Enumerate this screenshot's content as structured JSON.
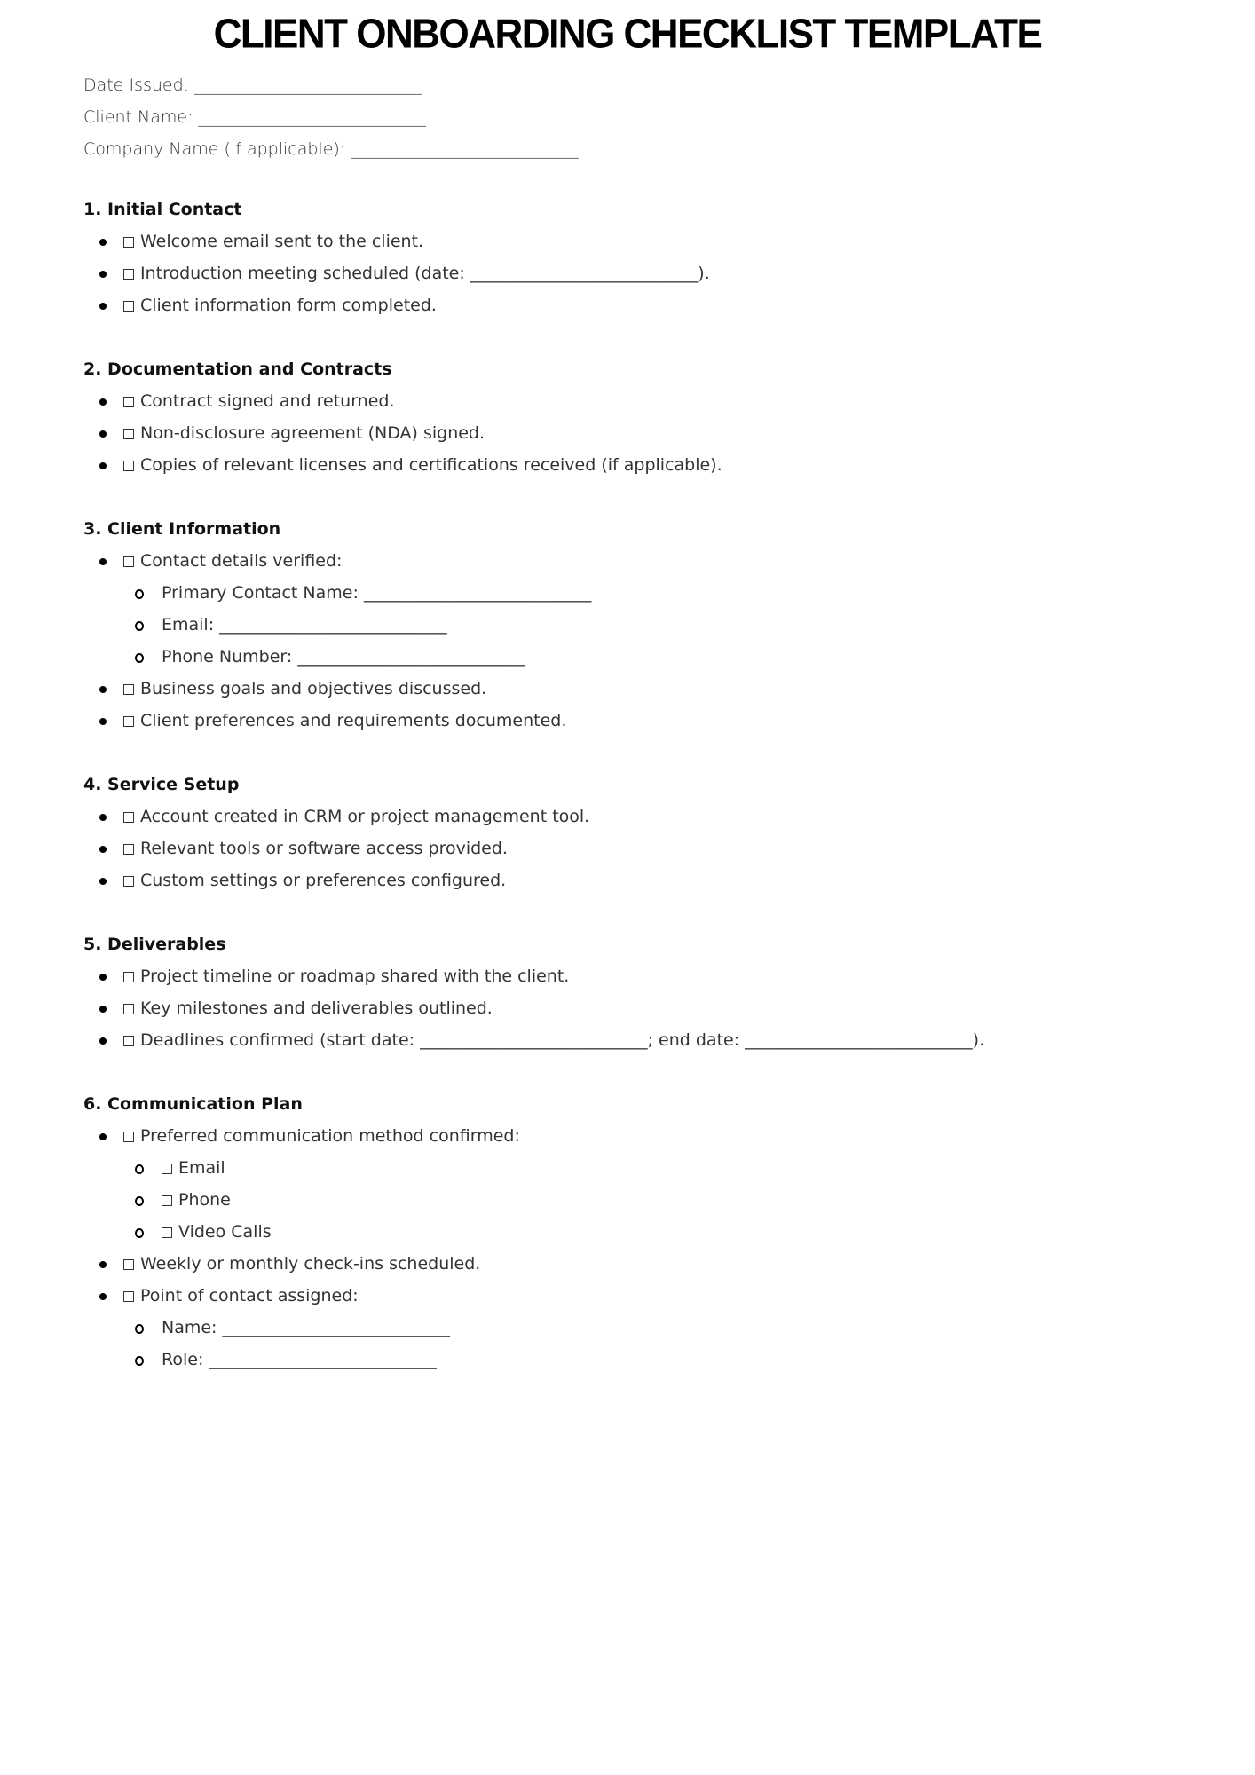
{
  "title": "CLIENT ONBOARDING CHECKLIST TEMPLATE",
  "meta": [
    "Date Issued: ___________________________",
    "Client Name: ___________________________",
    "Company Name (if applicable): ___________________________"
  ],
  "sections": [
    {
      "heading": "1. Initial Contact",
      "items": [
        {
          "text": "Welcome email sent to the client.",
          "checkbox": true
        },
        {
          "text": "Introduction meeting scheduled (date: ___________________________).",
          "checkbox": true
        },
        {
          "text": "Client information form completed.",
          "checkbox": true
        }
      ]
    },
    {
      "heading": "2. Documentation and Contracts",
      "items": [
        {
          "text": "Contract signed and returned.",
          "checkbox": true
        },
        {
          "text": "Non-disclosure agreement (NDA) signed.",
          "checkbox": true
        },
        {
          "text": "Copies of relevant licenses and certifications received (if applicable).",
          "checkbox": true
        }
      ]
    },
    {
      "heading": "3. Client Information",
      "items": [
        {
          "text": "Contact details verified:",
          "checkbox": true,
          "sub": [
            {
              "text": "Primary Contact Name: ___________________________",
              "checkbox": false
            },
            {
              "text": "Email: ___________________________",
              "checkbox": false
            },
            {
              "text": "Phone Number: ___________________________",
              "checkbox": false
            }
          ]
        },
        {
          "text": "Business goals and objectives discussed.",
          "checkbox": true
        },
        {
          "text": "Client preferences and requirements documented.",
          "checkbox": true
        }
      ]
    },
    {
      "heading": "4. Service Setup",
      "items": [
        {
          "text": "Account created in CRM or project management tool.",
          "checkbox": true
        },
        {
          "text": "Relevant tools or software access provided.",
          "checkbox": true
        },
        {
          "text": "Custom settings or preferences configured.",
          "checkbox": true
        }
      ]
    },
    {
      "heading": "5. Deliverables",
      "items": [
        {
          "text": "Project timeline or roadmap shared with the client.",
          "checkbox": true
        },
        {
          "text": "Key milestones and deliverables outlined.",
          "checkbox": true
        },
        {
          "text": "Deadlines confirmed (start date: ___________________________; end date: ___________________________).",
          "checkbox": true
        }
      ]
    },
    {
      "heading": "6. Communication Plan",
      "items": [
        {
          "text": "Preferred communication method confirmed:",
          "checkbox": true,
          "sub": [
            {
              "text": "Email",
              "checkbox": true
            },
            {
              "text": "Phone",
              "checkbox": true
            },
            {
              "text": "Video Calls",
              "checkbox": true
            }
          ]
        },
        {
          "text": "Weekly or monthly check-ins scheduled.",
          "checkbox": true
        },
        {
          "text": "Point of contact assigned:",
          "checkbox": true,
          "sub": [
            {
              "text": "Name: ___________________________",
              "checkbox": false
            },
            {
              "text": "Role: ___________________________",
              "checkbox": false
            }
          ]
        }
      ]
    }
  ]
}
